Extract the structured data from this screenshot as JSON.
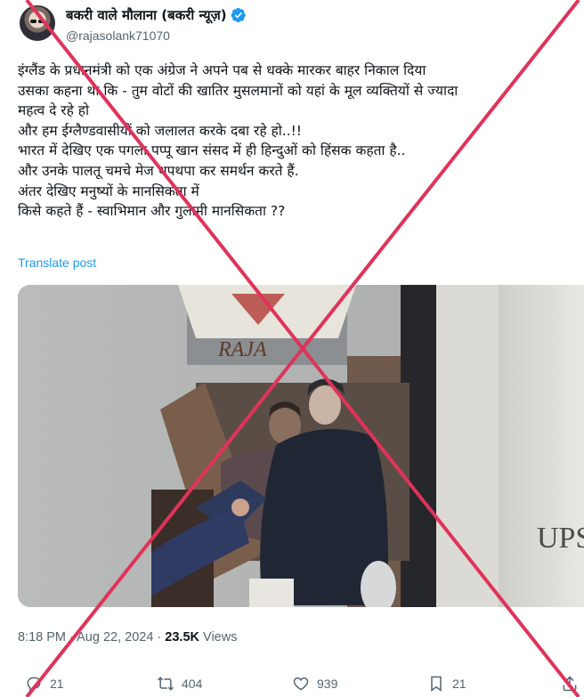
{
  "author": {
    "display_name": "बकरी वाले मौलाना (बकरी न्यूज़)",
    "handle": "@rajasolank71070"
  },
  "post": {
    "lines": [
      "इंग्लैंड के प्रधानमंत्री को एक अंग्रेज ने अपने पब से धक्के मारकर बाहर निकाल दिया",
      "उसका कहना था कि -  तुम वोटों की खातिर  मुसलमानों को यहां के मूल व्यक्तियों से ज्यादा",
      "महत्व दे रहे हो",
      "और हम ईग्लैण्डवासीयों  को जलालत करके दबा रहे हो..!!",
      "भारत में देखिए एक पगला पप्पू खान संसद में ही हिन्दुओं को हिंसक कहता है..",
      "और उनके  पालतू चमचे मेज थपथपा कर समर्थन करते हैं.",
      "अंतर देखिए मनुष्यों के मानसिकता में",
      "किसे कहते हैं - स्वाभिमान और गुलामी मानसिकता ??"
    ],
    "translate_label": "Translate post",
    "media": {
      "sign_text": "RAJA",
      "right_sign_text": "UPS"
    },
    "time": "8:18 PM",
    "date": "Aug 22, 2024",
    "views_count": "23.5K",
    "views_label": "Views",
    "separator": "·"
  },
  "actions": {
    "replies": "21",
    "reposts": "404",
    "likes": "939",
    "bookmarks": "21"
  },
  "overlay": {
    "cross_color": "#e0335a"
  },
  "icons": {
    "verified": "verified-badge-icon",
    "reply": "reply-icon",
    "repost": "repost-icon",
    "like": "like-icon",
    "bookmark": "bookmark-icon",
    "share": "share-icon"
  }
}
